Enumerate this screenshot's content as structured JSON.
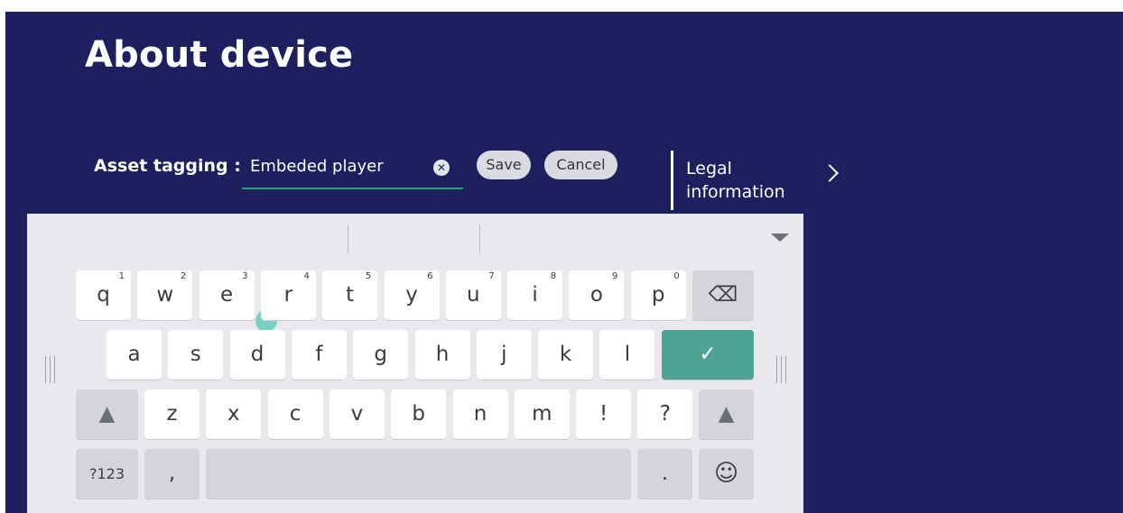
{
  "header": {
    "title": "About device"
  },
  "asset": {
    "label": "Asset tagging :",
    "value": "Embeded player",
    "clear_glyph": "✕",
    "save_label": "Save",
    "cancel_label": "Cancel"
  },
  "legal": {
    "line1": "Legal",
    "line2": "information",
    "chevron": "chevron-right-icon"
  },
  "keyboard": {
    "row1": [
      {
        "key": "q",
        "num": "1"
      },
      {
        "key": "w",
        "num": "2"
      },
      {
        "key": "e",
        "num": "3"
      },
      {
        "key": "r",
        "num": "4"
      },
      {
        "key": "t",
        "num": "5"
      },
      {
        "key": "y",
        "num": "6"
      },
      {
        "key": "u",
        "num": "7"
      },
      {
        "key": "i",
        "num": "8"
      },
      {
        "key": "o",
        "num": "9"
      },
      {
        "key": "p",
        "num": "0"
      }
    ],
    "row2": [
      "a",
      "s",
      "d",
      "f",
      "g",
      "h",
      "j",
      "k",
      "l"
    ],
    "row3": [
      "z",
      "x",
      "c",
      "v",
      "b",
      "n",
      "m",
      "!",
      "?"
    ],
    "symbols_label": "?123",
    "comma": ",",
    "period": ".",
    "enter_glyph": "✓",
    "backspace_glyph": "⌫",
    "shift_glyph": "▲",
    "emoji_glyph": "☺",
    "accent_color": "#4fa394",
    "background_color": "#1d1f5e"
  }
}
